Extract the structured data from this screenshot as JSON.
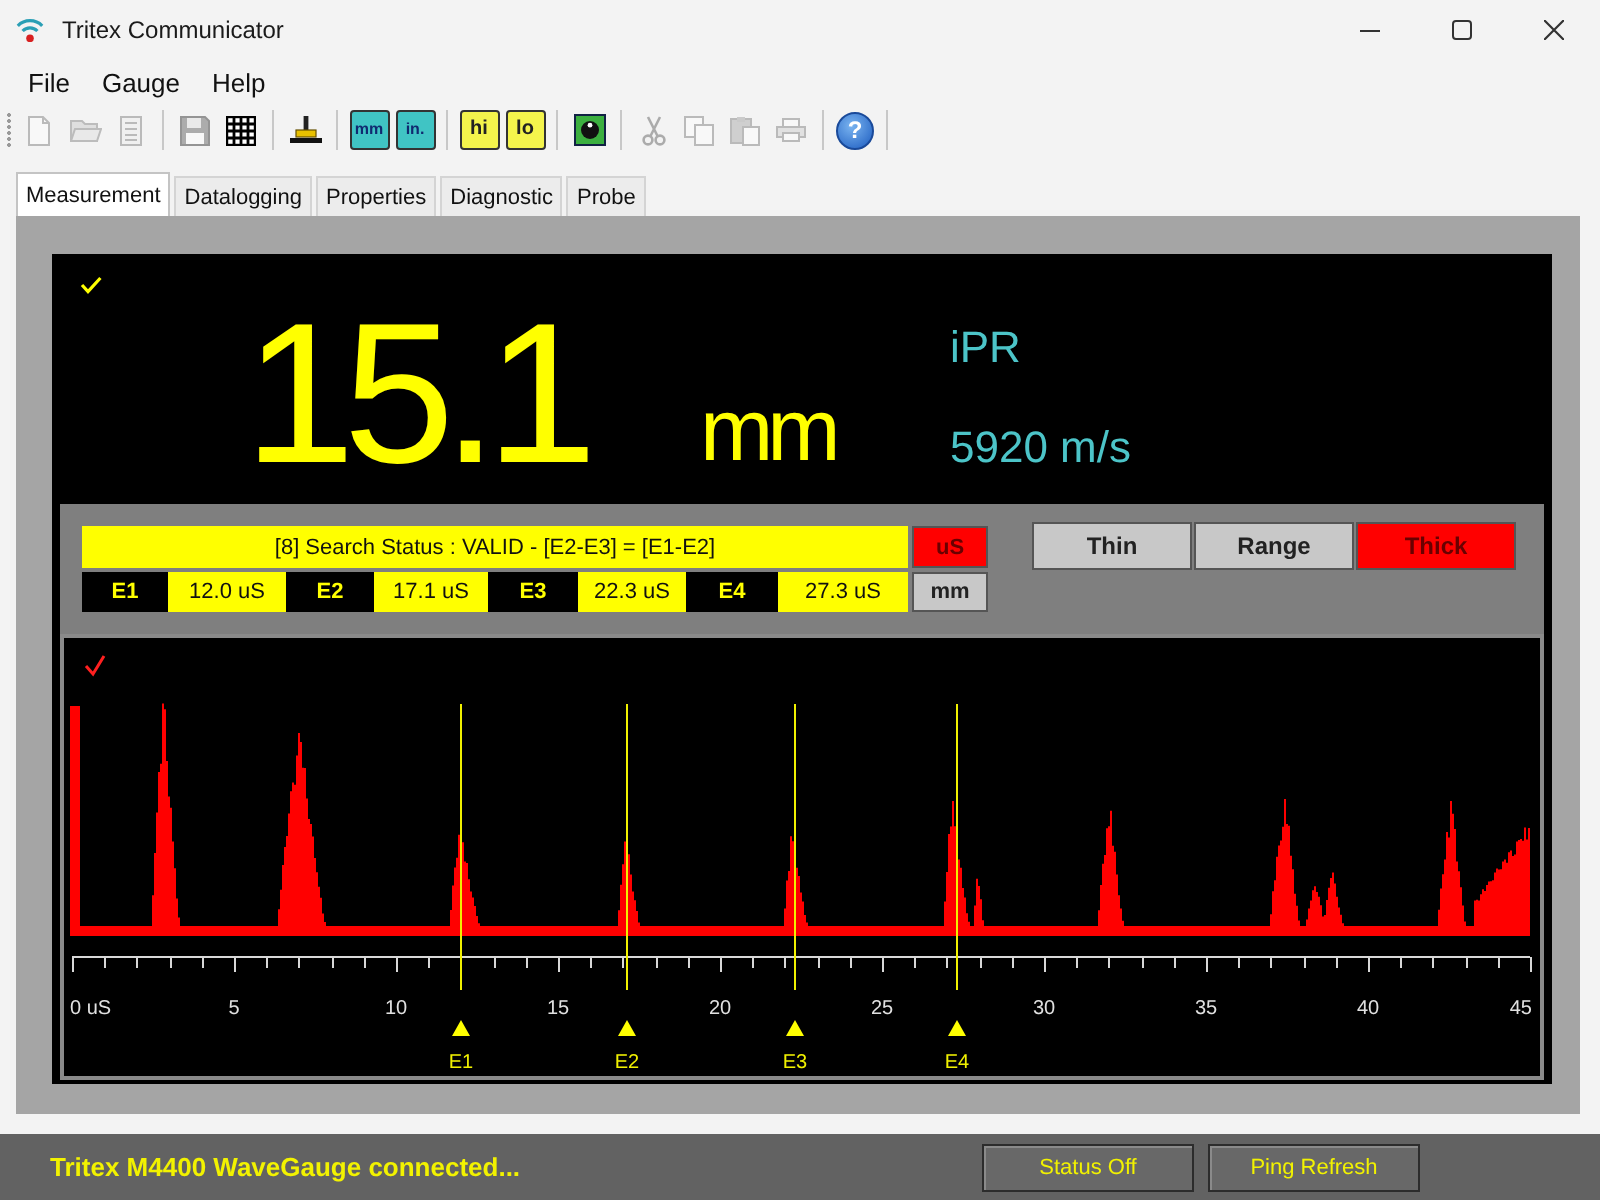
{
  "window": {
    "title": "Tritex Communicator"
  },
  "menu": [
    "File",
    "Gauge",
    "Help"
  ],
  "toolbar": {
    "groups": [
      {
        "items": [
          {
            "kind": "document",
            "disabled": true
          },
          {
            "kind": "folder",
            "disabled": true
          },
          {
            "kind": "list",
            "disabled": true
          }
        ]
      },
      {
        "items": [
          {
            "kind": "disk",
            "disabled": true
          },
          {
            "kind": "grid",
            "disabled": false
          }
        ]
      },
      {
        "items": [
          {
            "kind": "probe",
            "disabled": false
          }
        ]
      },
      {
        "items": [
          {
            "kind": "unit",
            "label": "mm",
            "disabled": false
          },
          {
            "kind": "unit",
            "label": "in.",
            "disabled": false
          }
        ]
      },
      {
        "items": [
          {
            "kind": "limit",
            "label": "hi",
            "disabled": false
          },
          {
            "kind": "limit",
            "label": "lo",
            "disabled": false
          }
        ]
      },
      {
        "items": [
          {
            "kind": "dial",
            "disabled": false
          }
        ]
      },
      {
        "items": [
          {
            "kind": "scissors",
            "disabled": true
          },
          {
            "kind": "copy",
            "disabled": true
          },
          {
            "kind": "clipboard",
            "disabled": true
          },
          {
            "kind": "printer",
            "disabled": true
          }
        ]
      },
      {
        "items": [
          {
            "kind": "help",
            "label": "?",
            "disabled": false
          }
        ]
      }
    ]
  },
  "tabs": [
    {
      "label": "Measurement",
      "selected": true
    },
    {
      "label": "Datalogging",
      "selected": false
    },
    {
      "label": "Properties",
      "selected": false
    },
    {
      "label": "Diagnostic",
      "selected": false
    },
    {
      "label": "Probe",
      "selected": false
    }
  ],
  "display": {
    "thickness": "15.1",
    "unit": "mm",
    "mode": "iPR",
    "velocity": "5920 m/s"
  },
  "search_status": {
    "text": "[8] Search Status : VALID - [E2-E3] = [E1-E2]",
    "units": [
      {
        "label": "uS",
        "selected": true
      },
      {
        "label": "mm",
        "selected": false
      }
    ],
    "echoes": [
      {
        "label": "E1",
        "value": "12.0 uS"
      },
      {
        "label": "E2",
        "value": "17.1 uS"
      },
      {
        "label": "E3",
        "value": "22.3 uS"
      },
      {
        "label": "E4",
        "value": "27.3 uS"
      }
    ]
  },
  "gate_modes": [
    {
      "label": "Thin",
      "selected": false
    },
    {
      "label": "Range",
      "selected": false
    },
    {
      "label": "Thick",
      "selected": true
    }
  ],
  "waveform": {
    "axis_labels": [
      "0 uS",
      "5",
      "10",
      "15",
      "20",
      "25",
      "30",
      "35",
      "40",
      "45"
    ],
    "markers": [
      {
        "label": "E1"
      },
      {
        "label": "E2"
      },
      {
        "label": "E3"
      },
      {
        "label": "E4"
      }
    ]
  },
  "status_bar": {
    "message": "Tritex M4400 WaveGauge connected...",
    "buttons": [
      "Status Off",
      "Ping Refresh"
    ]
  }
}
